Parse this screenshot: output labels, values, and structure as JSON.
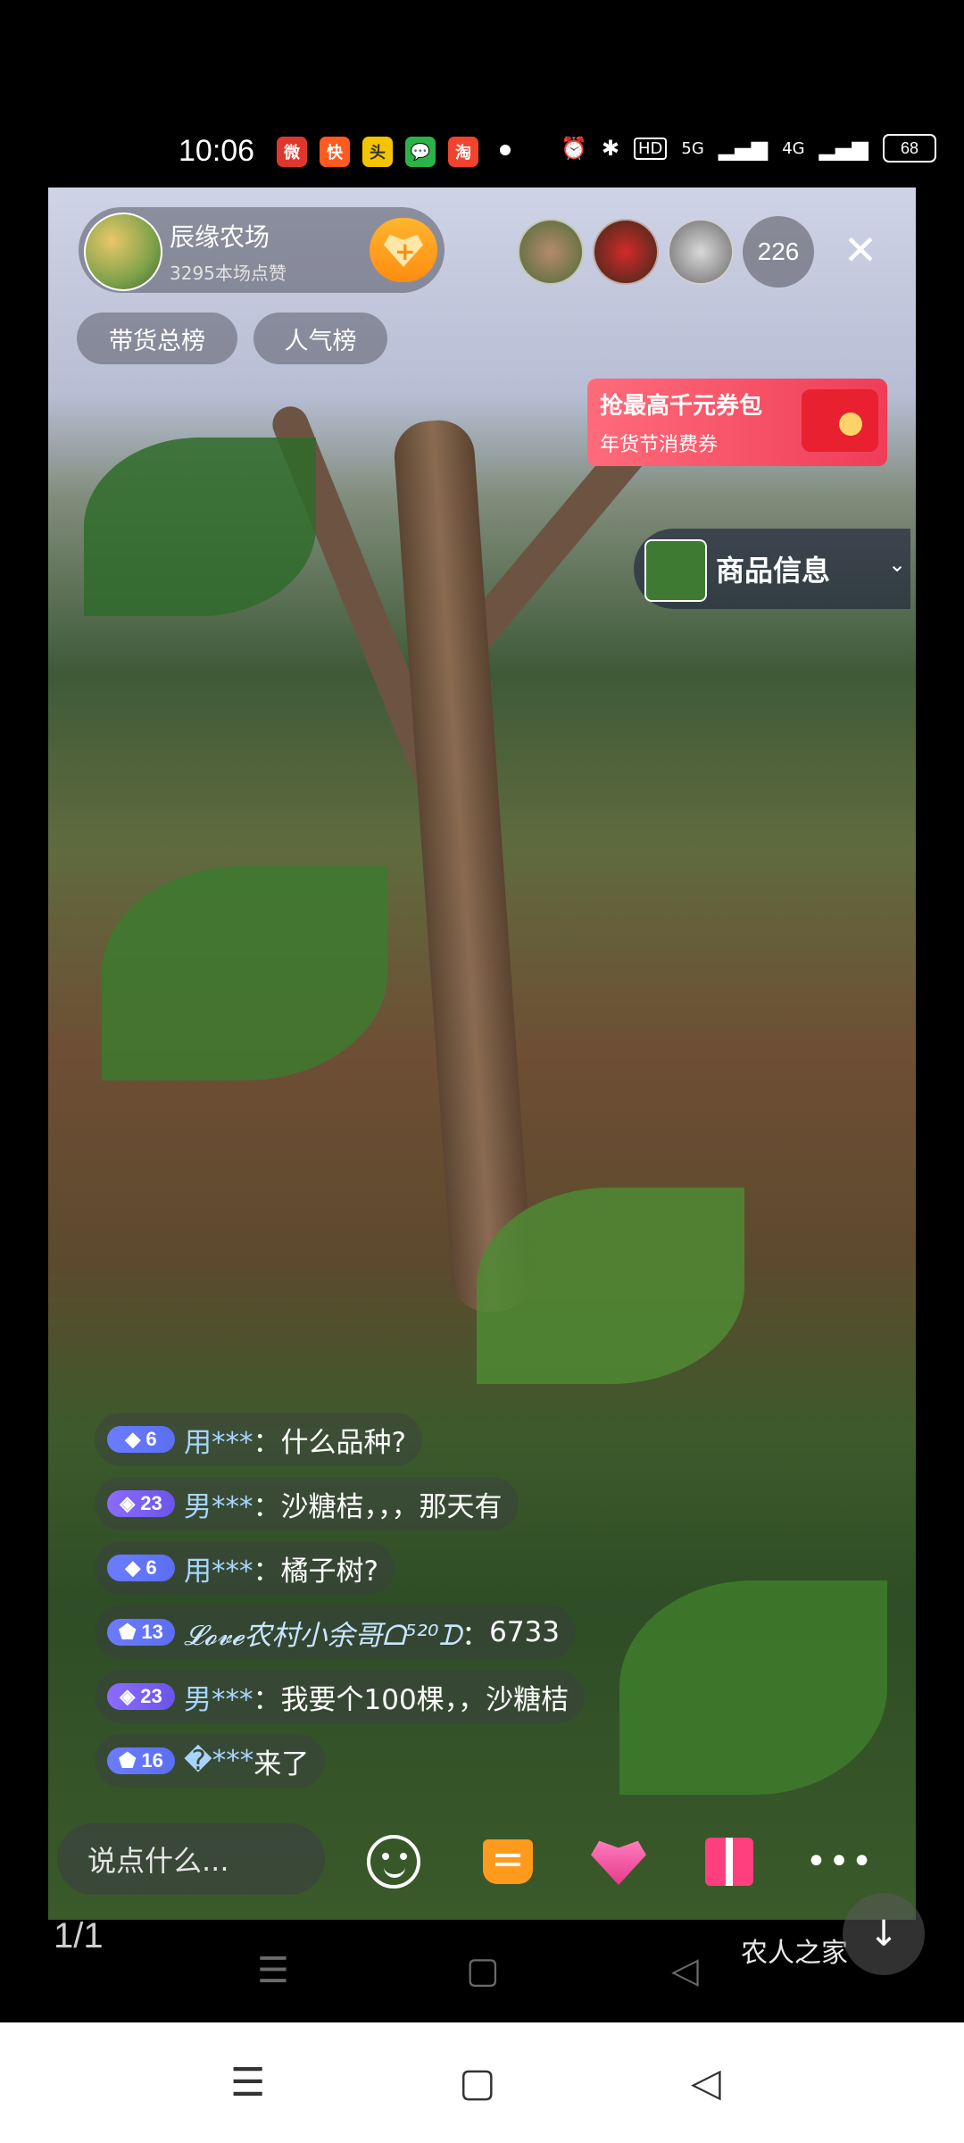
{
  "status_bar": {
    "time": "10:06",
    "app_icons": [
      {
        "name": "weibo-icon",
        "glyph": "微",
        "color": "#e0372c"
      },
      {
        "name": "kuaishou-icon",
        "glyph": "快",
        "color": "#ff5a1f"
      },
      {
        "name": "toutiao-icon",
        "glyph": "头",
        "color": "#f5c400"
      },
      {
        "name": "wechat-icon",
        "glyph": "💬",
        "color": "#2bb34a"
      },
      {
        "name": "taobao-icon",
        "glyph": "淘",
        "color": "#f1442f"
      }
    ],
    "system_icons": [
      "alarm-icon",
      "bluetooth-icon",
      "hd-icon",
      "signal-5g-icon",
      "signal-4g-icon"
    ],
    "hd": "HD",
    "net1": "5G",
    "net2": "4G",
    "battery": "68"
  },
  "host": {
    "name": "辰缘农场",
    "likes": "3295本场点赞"
  },
  "viewer_count": "226",
  "rank_tabs": [
    "带货总榜",
    "人气榜"
  ],
  "promo": {
    "title": "抢最高千元券包",
    "subtitle": "年货节消费券"
  },
  "product": {
    "label": "商品信息",
    "chevron": "⌄"
  },
  "comments": [
    {
      "level": "6",
      "badge": "blue",
      "user": "用***",
      "sep": "：",
      "text": "什么品种?"
    },
    {
      "level": "23",
      "badge": "purple",
      "user": "男***",
      "sep": "：",
      "text": "沙糖桔，，，那天有"
    },
    {
      "level": "6",
      "badge": "blue",
      "user": "用***",
      "sep": "：",
      "text": "橘子树?"
    },
    {
      "level": "13",
      "badge": "blue",
      "user": "𝓛𝓸𝓿𝓮农村小余哥ᗝ⁵²⁰ᗪ",
      "sep": "：",
      "text": "6733"
    },
    {
      "level": "23",
      "badge": "purple",
      "user": "男***",
      "sep": "：",
      "text": "我要个100棵，，沙糖桔"
    },
    {
      "level": "16",
      "badge": "blue",
      "user": "�***",
      "sep": " ",
      "text": "来了"
    }
  ],
  "input_placeholder": "说点什么...",
  "more_label": "•••",
  "page_indicator": "1/1",
  "watermark": "农人之家",
  "download_glyph": "↓",
  "nav": {
    "menu": "☰",
    "home": "▢",
    "back": "◁"
  }
}
